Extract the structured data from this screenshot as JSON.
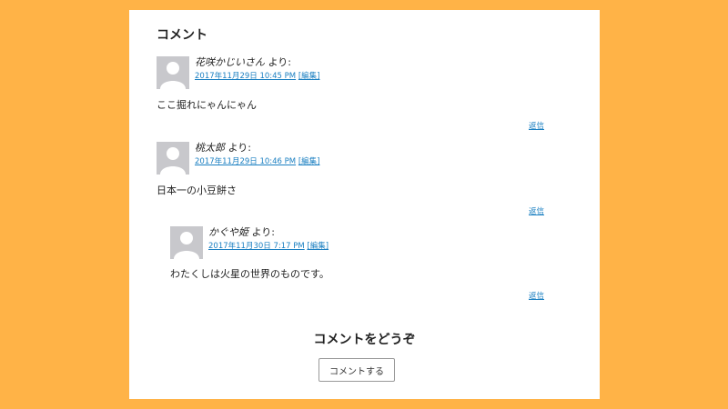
{
  "section_title": "コメント",
  "comments": [
    {
      "author": "花咲かじいさん",
      "says": "より:",
      "date": "2017年11月29日 10:45 PM",
      "edit_label": "[編集]",
      "text": "ここ掘れにゃんにゃん",
      "reply_label": "返信"
    },
    {
      "author": "桃太郎",
      "says": "より:",
      "date": "2017年11月29日 10:46 PM",
      "edit_label": "[編集]",
      "text": "日本一の小豆餅さ",
      "reply_label": "返信"
    },
    {
      "author": "かぐや姫",
      "says": "より:",
      "date": "2017年11月30日 7:17 PM",
      "edit_label": "[編集]",
      "text": "わたくしは火星の世界のものです。",
      "reply_label": "返信"
    }
  ],
  "respond": {
    "title": "コメントをどうぞ",
    "button_label": "コメントする"
  },
  "colors": {
    "background": "#ffb347",
    "link": "#1a7fc1",
    "avatar": "#c8c8cc"
  }
}
